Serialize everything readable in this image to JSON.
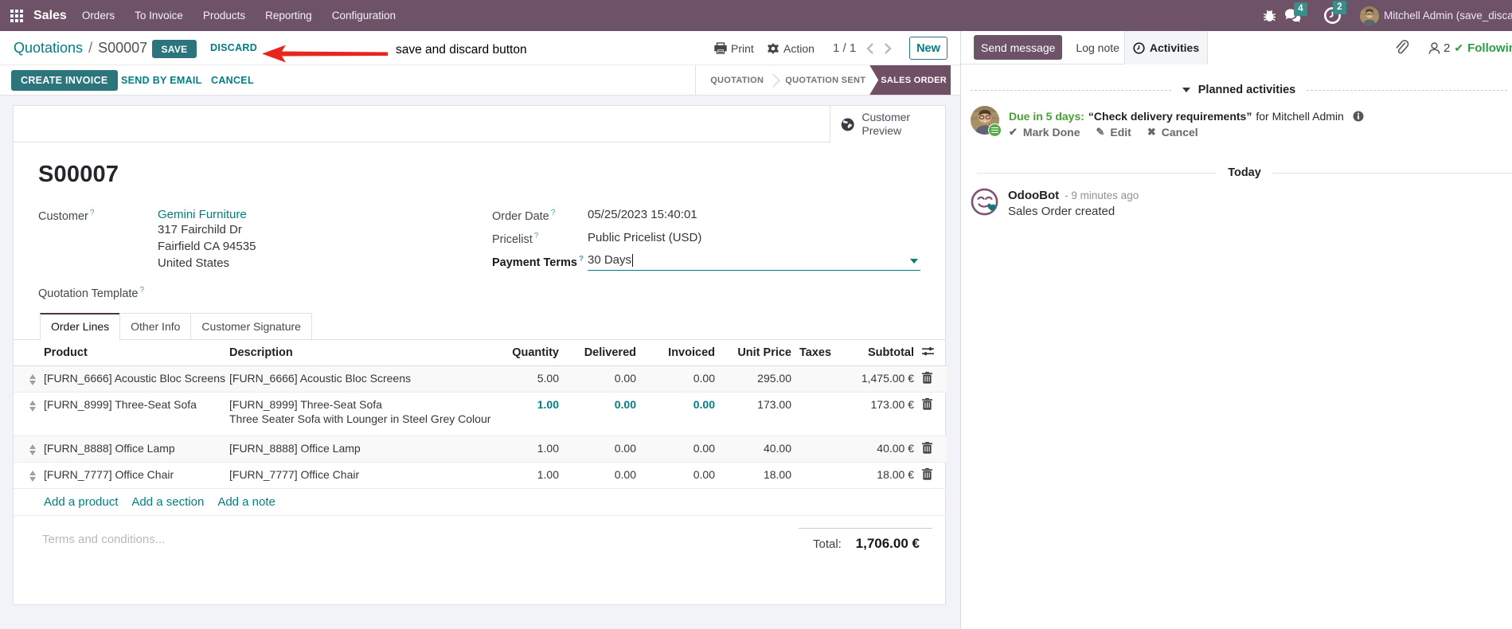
{
  "navbar": {
    "app_name": "Sales",
    "menus": [
      "Orders",
      "To Invoice",
      "Products",
      "Reporting",
      "Configuration"
    ],
    "messages_badge": "4",
    "activities_badge": "2",
    "user_name": "Mitchell Admin (save_discard"
  },
  "control_panel": {
    "breadcrumb_parent": "Quotations",
    "breadcrumb_sep": "/",
    "breadcrumb_current": "S00007",
    "save_label": "SAVE",
    "discard_label": "DISCARD",
    "print_label": "Print",
    "action_label": "Action",
    "pager": "1 / 1",
    "new_label": "New"
  },
  "annotation": {
    "text": "save and discard button",
    "color": "#e8251f"
  },
  "status_buttons": {
    "create_invoice": "CREATE INVOICE",
    "send_by_email": "SEND BY EMAIL",
    "cancel": "CANCEL"
  },
  "statusbar": {
    "steps": [
      "QUOTATION",
      "QUOTATION SENT",
      "SALES ORDER"
    ],
    "active_step": "SALES ORDER"
  },
  "sheet": {
    "customer_preview": "Customer Preview",
    "help_marker": "?",
    "title": "S00007",
    "fields": {
      "customer_label": "Customer",
      "customer_value": "Gemini Furniture",
      "address_line1": "317 Fairchild Dr",
      "address_line2": "Fairfield CA 94535",
      "address_line3": "United States",
      "quotation_template_label": "Quotation Template",
      "order_date_label": "Order Date",
      "order_date_value": "05/25/2023 15:40:01",
      "pricelist_label": "Pricelist",
      "pricelist_value": "Public Pricelist (USD)",
      "payment_terms_label": "Payment Terms",
      "payment_terms_value": "30 Days"
    },
    "tabs": [
      "Order Lines",
      "Other Info",
      "Customer Signature"
    ],
    "active_tab": "Order Lines",
    "table": {
      "headers": {
        "product": "Product",
        "description": "Description",
        "quantity": "Quantity",
        "delivered": "Delivered",
        "invoiced": "Invoiced",
        "unit_price": "Unit Price",
        "taxes": "Taxes",
        "subtotal": "Subtotal"
      },
      "rows": [
        {
          "product": "[FURN_6666] Acoustic Bloc Screens",
          "description": "[FURN_6666] Acoustic Bloc Screens",
          "description2": "",
          "quantity": "5.00",
          "delivered": "0.00",
          "invoiced": "0.00",
          "unit_price": "295.00",
          "taxes": "",
          "subtotal": "1,475.00 €"
        },
        {
          "product": "[FURN_8999] Three-Seat Sofa",
          "description": "[FURN_8999] Three-Seat Sofa",
          "description2": "Three Seater Sofa with Lounger in Steel Grey Colour",
          "quantity": "1.00",
          "delivered": "0.00",
          "invoiced": "0.00",
          "unit_price": "173.00",
          "taxes": "",
          "subtotal": "173.00 €"
        },
        {
          "product": "[FURN_8888] Office Lamp",
          "description": "[FURN_8888] Office Lamp",
          "description2": "",
          "quantity": "1.00",
          "delivered": "0.00",
          "invoiced": "0.00",
          "unit_price": "40.00",
          "taxes": "",
          "subtotal": "40.00 €"
        },
        {
          "product": "[FURN_7777] Office Chair",
          "description": "[FURN_7777] Office Chair",
          "description2": "",
          "quantity": "1.00",
          "delivered": "0.00",
          "invoiced": "0.00",
          "unit_price": "18.00",
          "taxes": "",
          "subtotal": "18.00 €"
        }
      ],
      "add_product": "Add a product",
      "add_section": "Add a section",
      "add_note": "Add a note"
    },
    "terms_placeholder": "Terms and conditions...",
    "total_label": "Total:",
    "total_value": "1,706.00 €"
  },
  "chatter": {
    "send_message": "Send message",
    "log_note": "Log note",
    "activities": "Activities",
    "followers_count": "2",
    "following": "Following",
    "planned_activities": "Planned activities",
    "activity": {
      "due": "Due in 5 days:",
      "summary": "“Check delivery requirements”",
      "for_user": "for Mitchell Admin",
      "mark_done": "Mark Done",
      "edit": "Edit",
      "cancel": "Cancel"
    },
    "today": "Today",
    "message": {
      "author": "OdooBot",
      "time": "- 9 minutes ago",
      "body": "Sales Order created"
    }
  }
}
